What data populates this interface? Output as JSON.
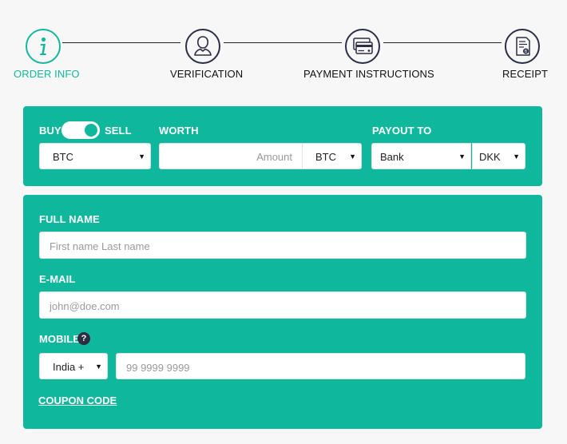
{
  "steps": [
    {
      "label": "ORDER INFO",
      "icon": "info-icon",
      "active": true
    },
    {
      "label": "VERIFICATION",
      "icon": "user-icon",
      "active": false
    },
    {
      "label": "PAYMENT INSTRUCTIONS",
      "icon": "card-icon",
      "active": false
    },
    {
      "label": "RECEIPT",
      "icon": "receipt-icon",
      "active": false
    }
  ],
  "colors": {
    "accent": "#0fb89c",
    "dark": "#2d2d44",
    "background": "#f7f7f7"
  },
  "trade": {
    "buy_label": "BUY",
    "sell_label": "SELL",
    "mode": "SELL",
    "coin_value": "BTC",
    "worth_label": "WORTH",
    "amount_placeholder": "Amount",
    "amount_currency": "BTC",
    "payout_label": "PAYOUT TO",
    "payout_method": "Bank",
    "payout_currency": "DKK"
  },
  "form": {
    "full_name_label": "FULL NAME",
    "full_name_placeholder": "First name Last name",
    "email_label": "E-MAIL",
    "email_placeholder": "john@doe.com",
    "mobile_label": "MOBILE",
    "help_glyph": "?",
    "country_code": "India +",
    "phone_placeholder": "99 9999 9999",
    "coupon_label": "COUPON CODE"
  }
}
